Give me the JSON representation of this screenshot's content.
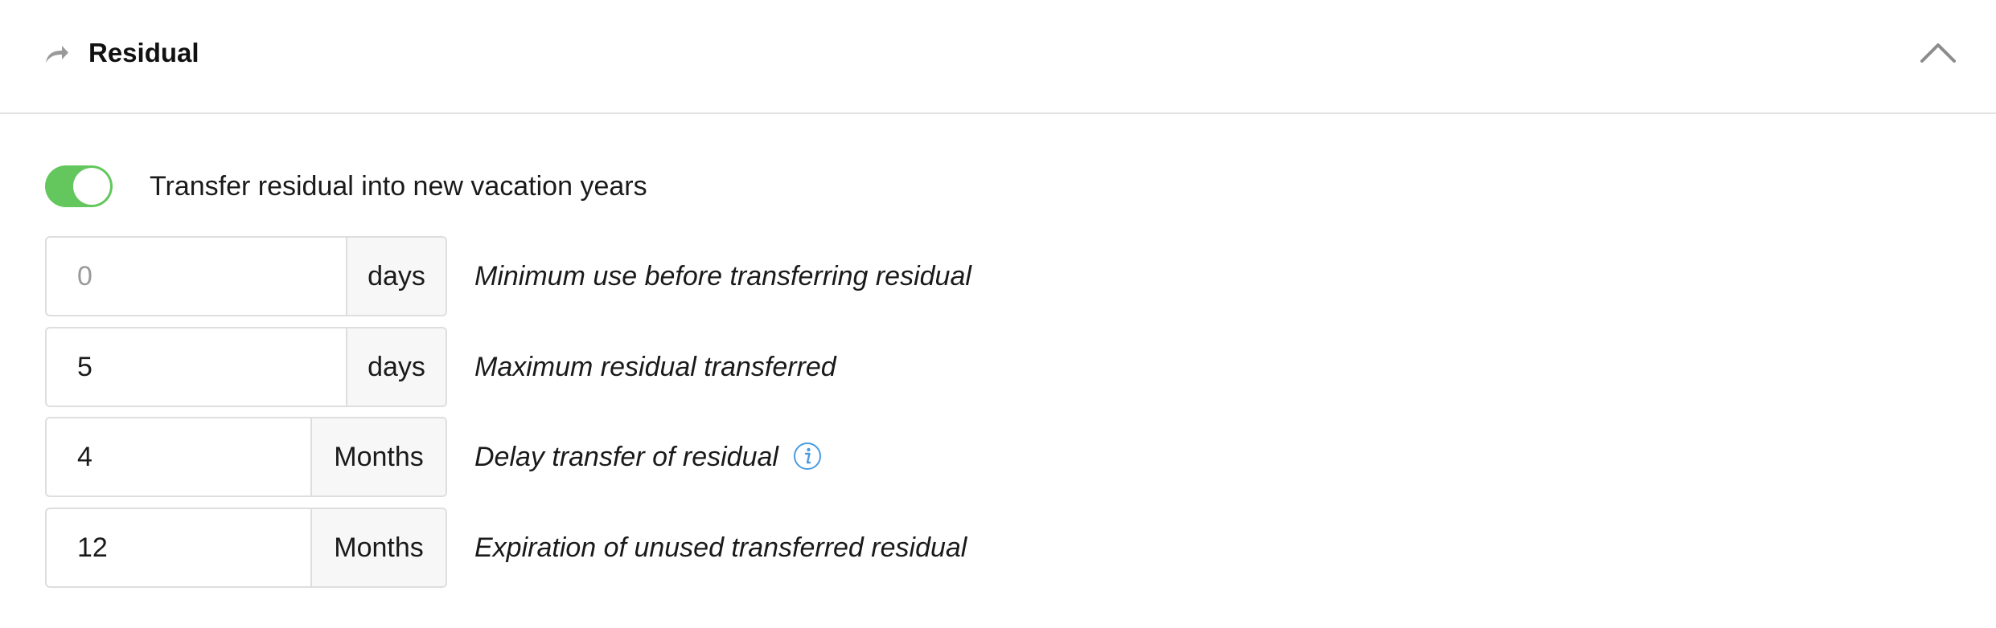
{
  "header": {
    "title": "Residual",
    "icon": "share-arrow-icon",
    "collapse_icon": "chevron-up-icon"
  },
  "transfer_toggle": {
    "label": "Transfer residual into new vacation years",
    "enabled": true,
    "on_color": "#63c75d"
  },
  "fields": [
    {
      "value": "",
      "placeholder": "0",
      "unit": "days",
      "description": "Minimum use before transferring residual"
    },
    {
      "value": "5",
      "placeholder": "",
      "unit": "days",
      "description": "Maximum residual transferred"
    },
    {
      "value": "4",
      "placeholder": "",
      "unit": "Months",
      "description": "Delay transfer of residual",
      "info_icon": "info-icon"
    },
    {
      "value": "12",
      "placeholder": "",
      "unit": "Months",
      "description": "Expiration of unused transferred residual"
    }
  ],
  "colors": {
    "info_blue": "#4a9be0",
    "border": "#dedede",
    "unit_background": "#f7f7f7"
  }
}
